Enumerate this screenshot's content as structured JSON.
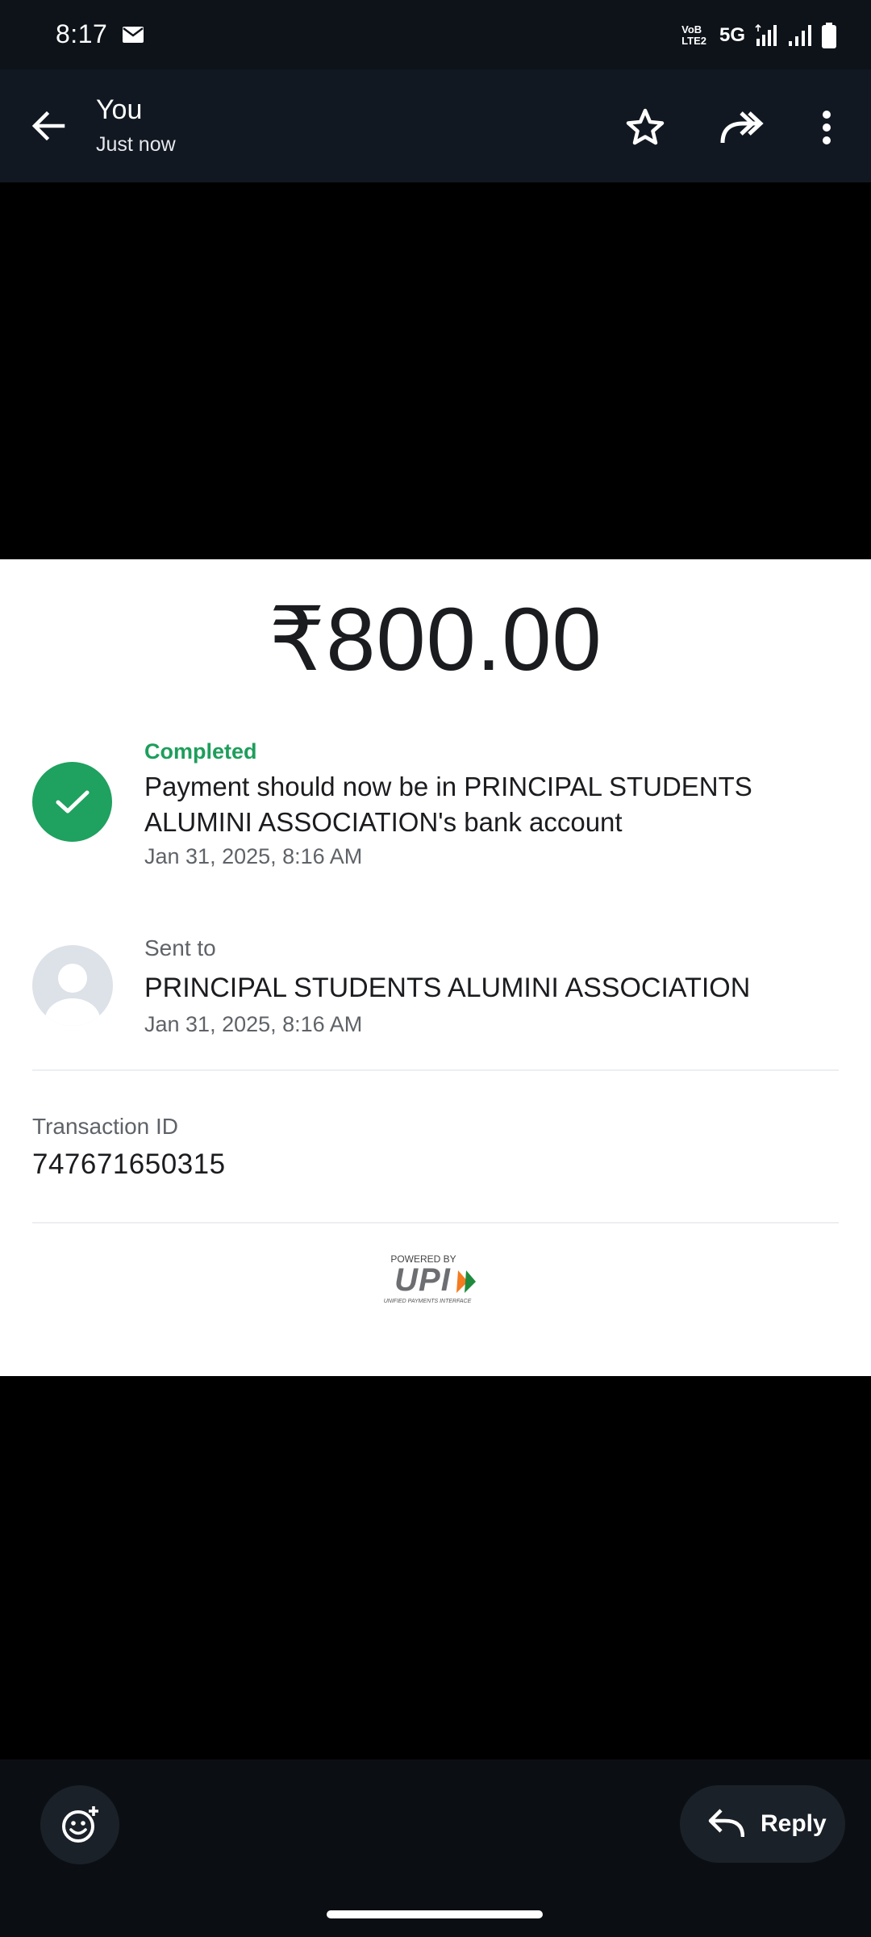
{
  "status_bar": {
    "time": "8:17",
    "volte_line1": "VoB",
    "volte_line2": "LTE2",
    "network": "5G",
    "icons": [
      "mail-icon",
      "signal-icon",
      "signal-icon",
      "battery-icon"
    ]
  },
  "app_bar": {
    "title": "You",
    "subtitle": "Just now",
    "icons": [
      "back-arrow-icon",
      "star-icon",
      "forward-icon",
      "more-vert-icon"
    ]
  },
  "receipt": {
    "amount": "₹800.00",
    "status_label": "Completed",
    "status_message": "Payment should now be in PRINCIPAL STUDENTS ALUMINI ASSOCIATION's bank account",
    "status_date": "Jan 31, 2025, 8:16 AM",
    "sent_label": "Sent to",
    "recipient": "PRINCIPAL STUDENTS ALUMINI ASSOCIATION",
    "sent_date": "Jan 31, 2025, 8:16 AM",
    "transaction_label": "Transaction ID",
    "transaction_id": "747671650315",
    "upi_powered_by": "POWERED BY",
    "upi_mark": "UPI",
    "upi_tagline": "UNIFIED PAYMENTS INTERFACE"
  },
  "bottom_bar": {
    "reply_label": "Reply",
    "icons": [
      "add-reaction-icon",
      "reply-icon"
    ]
  },
  "colors": {
    "completed_green": "#1e9e5c",
    "app_bar_bg": "#111821",
    "bottom_bar_bg": "#0b0f14"
  }
}
